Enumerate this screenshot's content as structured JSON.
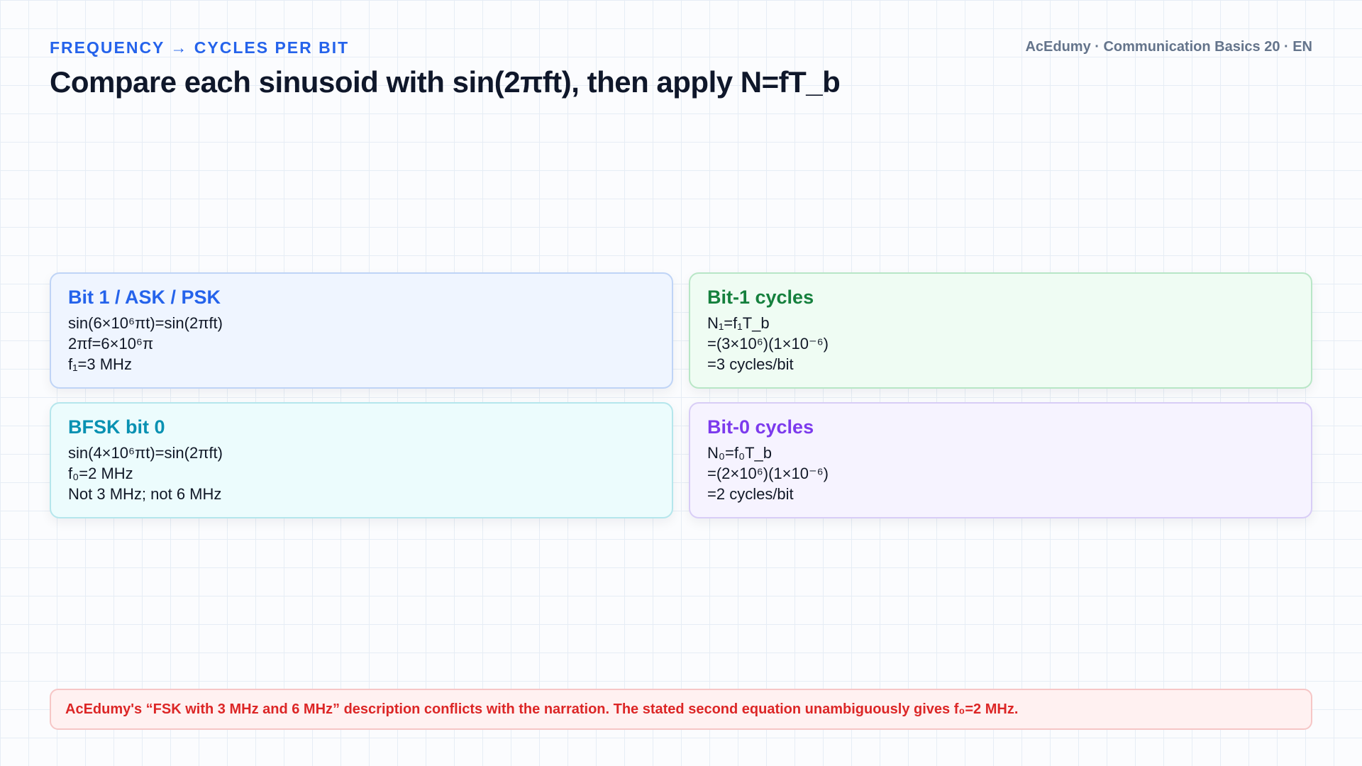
{
  "header": {
    "kicker": "FREQUENCY → CYCLES PER BIT",
    "brand": "AcEdumy · Communication Basics 20 · EN",
    "title": "Compare each sinusoid with sin(2πft), then apply N=fT_b"
  },
  "colors": {
    "accent_blue": "#2563eb",
    "accent_green": "#15803d",
    "accent_cyan": "#0891b2",
    "accent_purple": "#7c3aed",
    "warning_red": "#dc2626"
  },
  "cards": [
    {
      "title": "Bit 1 / ASK / PSK",
      "lines": [
        "sin(6×10⁶πt)=sin(2πft)",
        "2πf=6×10⁶π",
        "f₁=3 MHz"
      ]
    },
    {
      "title": "Bit-1 cycles",
      "lines": [
        "N₁=f₁T_b",
        "=(3×10⁶)(1×10⁻⁶)",
        "=3 cycles/bit"
      ]
    },
    {
      "title": "BFSK bit 0",
      "lines": [
        "sin(4×10⁶πt)=sin(2πft)",
        "f₀=2 MHz",
        "Not 3 MHz; not 6 MHz"
      ]
    },
    {
      "title": "Bit-0 cycles",
      "lines": [
        "N₀=f₀T_b",
        "=(2×10⁶)(1×10⁻⁶)",
        "=2 cycles/bit"
      ]
    }
  ],
  "note": "AcEdumy's “FSK with 3 MHz and 6 MHz” description conflicts with the narration. The stated second equation unambiguously gives f₀=2 MHz."
}
